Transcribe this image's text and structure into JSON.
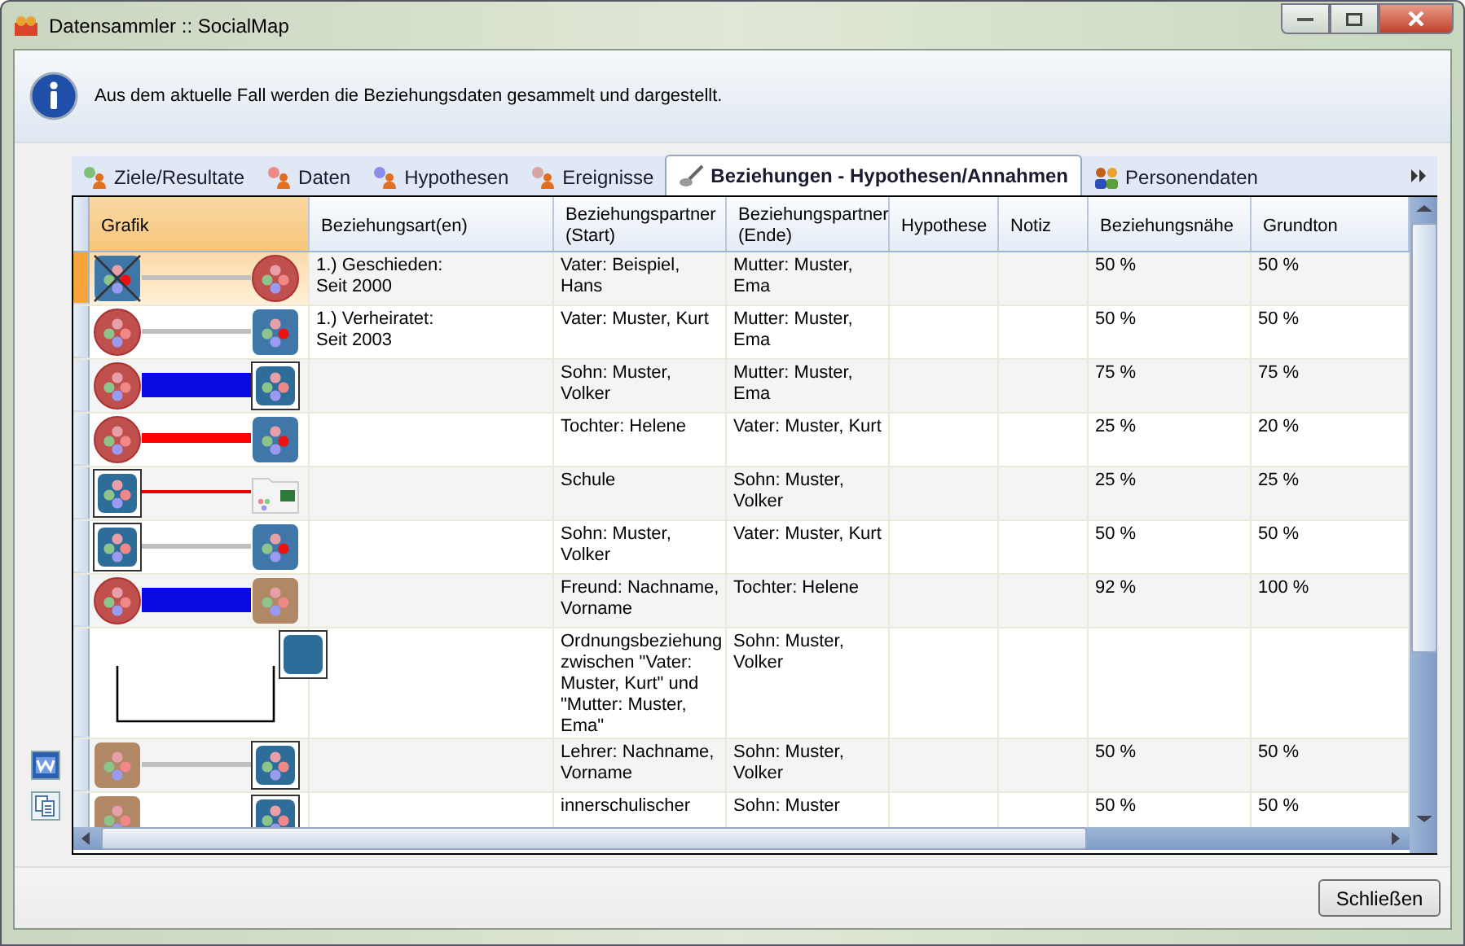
{
  "window": {
    "title": "Datensammler :: SocialMap"
  },
  "info": {
    "message": "Aus dem aktuelle Fall werden die Beziehungsdaten gesammelt und dargestellt."
  },
  "tabs": [
    {
      "label": "Ziele/Resultate",
      "kind": "person",
      "color": "#7cc07a",
      "selected": false
    },
    {
      "label": "Daten",
      "kind": "person",
      "color": "#ee8a8a",
      "selected": false
    },
    {
      "label": "Hypothesen",
      "kind": "person",
      "color": "#8c8cea",
      "selected": false
    },
    {
      "label": "Ereignisse",
      "kind": "person",
      "color": "#d9a4a4",
      "selected": false
    },
    {
      "label": "Beziehungen - Hypothesen/Annahmen",
      "kind": "brush",
      "selected": true
    },
    {
      "label": "Personendaten",
      "kind": "people",
      "selected": false
    }
  ],
  "table": {
    "columns": [
      "Grafik",
      "Beziehungsart(en)",
      "Beziehungspartner (Start)",
      "Beziehungspartner (Ende)",
      "Hypothese",
      "Notiz",
      "Beziehungsnähe",
      "Grundton"
    ],
    "rows": [
      {
        "selected": true,
        "start_node": {
          "kind": "male",
          "crossed": true
        },
        "end_node": {
          "kind": "female"
        },
        "connector": {
          "kind": "gray"
        },
        "type": [
          "1.) Geschieden:",
          "Seit 2000"
        ],
        "start": "Vater: Beispiel, Hans",
        "end": "Mutter: Muster, Ema",
        "closeness": "50 %",
        "tone": "50 %"
      },
      {
        "selected": false,
        "start_node": {
          "kind": "female",
          "crossed": false
        },
        "end_node": {
          "kind": "male"
        },
        "connector": {
          "kind": "gray"
        },
        "type": [
          "1.) Verheiratet:",
          "Seit 2003"
        ],
        "start": "Vater: Muster, Kurt",
        "end": "Mutter: Muster, Ema",
        "closeness": "50 %",
        "tone": "50 %"
      },
      {
        "selected": false,
        "start_node": {
          "kind": "female",
          "crossed": false
        },
        "end_node": {
          "kind": "male-framed"
        },
        "connector": {
          "kind": "blue-thick"
        },
        "start": "Sohn: Muster, Volker",
        "end": "Mutter: Muster, Ema",
        "closeness": "75 %",
        "tone": "75 %"
      },
      {
        "selected": false,
        "start_node": {
          "kind": "female",
          "crossed": false
        },
        "end_node": {
          "kind": "male"
        },
        "connector": {
          "kind": "red"
        },
        "start": "Tochter: Helene",
        "end": "Vater: Muster, Kurt",
        "closeness": "25 %",
        "tone": "20 %"
      },
      {
        "selected": false,
        "start_node": {
          "kind": "male-framed",
          "crossed": false
        },
        "end_node": {
          "kind": "institution"
        },
        "connector": {
          "kind": "red-thin"
        },
        "start": "Schule",
        "end": "Sohn: Muster, Volker",
        "closeness": "25 %",
        "tone": "25 %"
      },
      {
        "selected": false,
        "start_node": {
          "kind": "male-framed",
          "crossed": false
        },
        "end_node": {
          "kind": "male"
        },
        "connector": {
          "kind": "gray"
        },
        "start": "Sohn: Muster, Volker",
        "end": "Vater: Muster, Kurt",
        "closeness": "50 %",
        "tone": "50 %"
      },
      {
        "selected": false,
        "start_node": {
          "kind": "female",
          "crossed": false
        },
        "end_node": {
          "kind": "other"
        },
        "connector": {
          "kind": "blue-thick"
        },
        "start": "Freund: Nachname, Vorname",
        "end": "Tochter: Helene",
        "closeness": "92 %",
        "tone": "100 %"
      },
      {
        "selected": false,
        "end_node": {
          "kind": "plain-framed"
        },
        "connector": {
          "kind": "elbow"
        },
        "start": "Ordnungsbeziehung zwischen \"Vater: Muster, Kurt\" und \"Mutter: Muster, Ema\"",
        "end": "Sohn: Muster, Volker"
      },
      {
        "selected": false,
        "start_node": {
          "kind": "other",
          "crossed": false
        },
        "end_node": {
          "kind": "male-framed"
        },
        "connector": {
          "kind": "gray"
        },
        "start": "Lehrer: Nachname, Vorname",
        "end": "Sohn: Muster, Volker",
        "closeness": "50 %",
        "tone": "50 %"
      },
      {
        "selected": false,
        "start_node": {
          "kind": "other",
          "crossed": false
        },
        "end_node": {
          "kind": "male-framed"
        },
        "start": "innerschulischer",
        "end": "Sohn: Muster",
        "closeness": "50 %",
        "tone": "50 %"
      }
    ]
  },
  "buttons": [
    "Schließen"
  ]
}
